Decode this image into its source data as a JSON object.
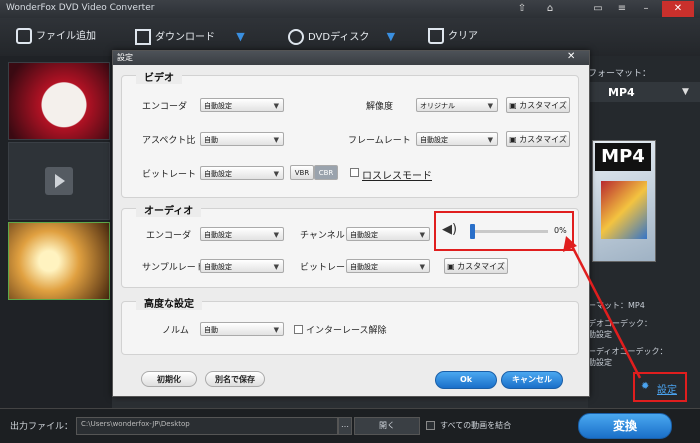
{
  "window": {
    "title": "WonderFox DVD Video Converter"
  },
  "toolbar": {
    "add_file": "ファイル追加",
    "download": "ダウンロード",
    "dvd_disc": "DVDディスク",
    "clear": "クリア"
  },
  "right_panel": {
    "format_label": "フォーマット：",
    "format_value": "MP4",
    "thumb_text": "MP4",
    "info_format": "ーマット：MP4",
    "info_video_codec": "デオコーデック：",
    "info_video_val": "動設定",
    "info_audio_codec": "ーディオコーデック：",
    "info_audio_val": "動設定",
    "settings_link": "設定"
  },
  "bottom": {
    "output_label": "出力ファイル：",
    "output_path": "C:\\Users\\wonderfox-JP\\Desktop",
    "browse": "…",
    "open": "開く",
    "merge_label": "すべての動画を結合",
    "convert": "変換"
  },
  "dialog": {
    "title": "設定",
    "video": {
      "title": "ビデオ",
      "encoder_label": "エンコーダ",
      "encoder_value": "自動設定",
      "resolution_label": "解像度",
      "resolution_value": "オリジナル",
      "customize": "カスタマイズ",
      "aspect_label": "アスペクト比",
      "aspect_value": "自動",
      "framerate_label": "フレームレート",
      "framerate_value": "自動設定",
      "bitrate_label": "ビットレート",
      "bitrate_value": "自動設定",
      "vbr": "VBR",
      "cbr": "CBR",
      "lossless_label": "ロスレスモード"
    },
    "audio": {
      "title": "オーディオ",
      "encoder_label": "エンコーダ",
      "encoder_value": "自動設定",
      "channel_label": "チャンネル",
      "channel_value": "自動設定",
      "volume_level": 0,
      "volume_text": "0%",
      "samplerate_label": "サンプルレート",
      "samplerate_value": "自動設定",
      "bitrate_label": "ビットレート",
      "bitrate_value": "自動設定",
      "customize": "カスタマイズ"
    },
    "advanced": {
      "title": "高度な設定",
      "norm_label": "ノルム",
      "norm_value": "自動",
      "deinterlace_label": "インターレース解除"
    },
    "reset": "初期化",
    "save_as": "別名で保存",
    "ok": "Ok",
    "cancel": "キャンセル"
  }
}
